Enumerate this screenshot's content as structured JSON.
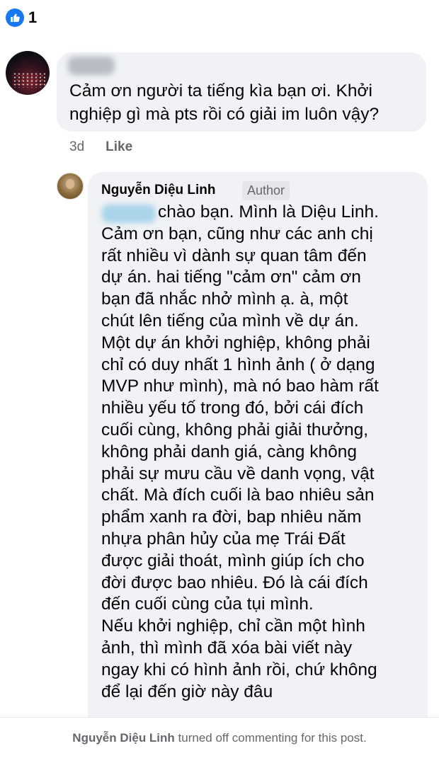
{
  "reactions": {
    "count": "1",
    "icon": "thumbs-up-icon",
    "color": "#1877f2"
  },
  "comment": {
    "text_lines": [
      "Cảm ơn người ta tiếng kìa bạn ơi. Khởi",
      "nghiệp gì mà pts rồi có giải im luôn vậy?"
    ],
    "time": "3d",
    "like_label": "Like"
  },
  "reply": {
    "author": "Nguyễn Diệu Linh",
    "badge": "Author",
    "lines": [
      "chào bạn. Mình là Diệu Linh.",
      "Cảm ơn bạn, cũng như các anh chị",
      "rất nhiều vì dành sự quan tâm đến",
      "dự án. hai tiếng \"cảm ơn\" cảm ơn",
      "bạn đã nhắc nhở mình ạ. à, một",
      "chút lên tiếng của mình về dự án.",
      "Một dự án khởi nghiệp, không phải",
      "chỉ có duy nhất 1 hình ảnh ( ở dạng",
      "MVP như mình), mà nó bao hàm rất",
      "nhiều yếu tố trong đó, bởi cái đích",
      "cuối cùng, không phải giải thưởng,",
      "không phải danh giá, càng không",
      "phải sự mưu cầu về danh vọng, vật",
      "chất. Mà đích cuối là bao nhiêu sản",
      "phẩm xanh ra đời, bap nhiêu năm",
      "nhựa phân hủy của mẹ Trái Đất",
      "được giải thoát, mình giúp ích cho",
      "đời được bao nhiêu. Đó là cái đích",
      "đến cuối cùng của tụi mình.",
      "Nếu khởi nghiệp, chỉ cần một hình",
      "ảnh, thì mình đã xóa bài viết này",
      "ngay khi có hình ảnh rồi, chứ không",
      "để lại đến giờ này đâu"
    ]
  },
  "footer": {
    "name": "Nguyễn Diệu Linh",
    "message": "turned off commenting for this post."
  }
}
